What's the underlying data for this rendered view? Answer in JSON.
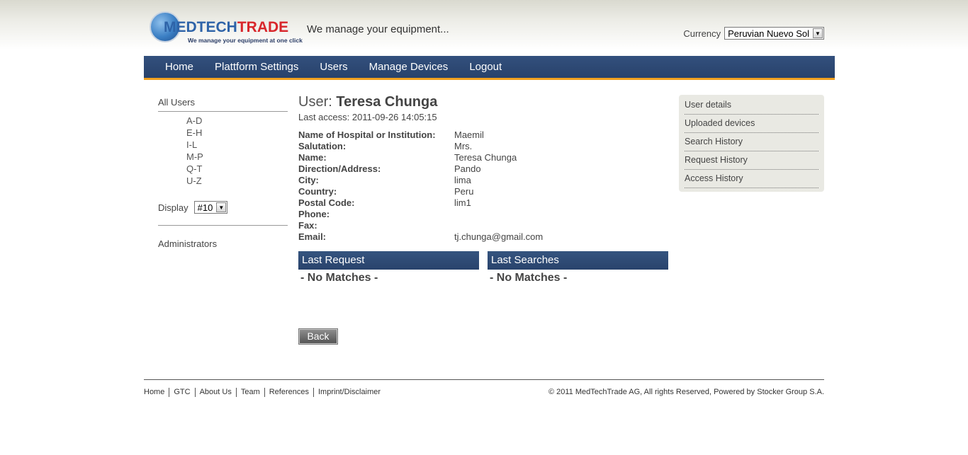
{
  "header": {
    "logo_med": "MEDTECH",
    "logo_trade": "TRADE",
    "logo_tagline": "We manage your equipment at one click",
    "tagline": "We manage your equipment...",
    "currency_label": "Currency",
    "currency_value": "Peruvian Nuevo Sol"
  },
  "nav": [
    "Home",
    "Plattform Settings",
    "Users",
    "Manage Devices",
    "Logout"
  ],
  "sidebar": {
    "all_users": "All Users",
    "letters": [
      "A-D",
      "E-H",
      "I-L",
      "M-P",
      "Q-T",
      "U-Z"
    ],
    "display_label": "Display",
    "display_value": "#10",
    "administrators": "Administrators"
  },
  "user": {
    "title_prefix": "User:",
    "name": "Teresa Chunga",
    "last_access": "Last access: 2011-09-26 14:05:15",
    "fields": [
      {
        "label": "Name of Hospital or Institution:",
        "value": "Maemil"
      },
      {
        "label": "Salutation:",
        "value": "Mrs."
      },
      {
        "label": "Name:",
        "value": "Teresa Chunga"
      },
      {
        "label": "Direction/Address:",
        "value": "Pando"
      },
      {
        "label": "City:",
        "value": "lima"
      },
      {
        "label": "Country:",
        "value": "Peru"
      },
      {
        "label": "Postal Code:",
        "value": "lim1"
      },
      {
        "label": "Phone:",
        "value": ""
      },
      {
        "label": "Fax:",
        "value": ""
      },
      {
        "label": "Email:",
        "value": "tj.chunga@gmail.com"
      }
    ]
  },
  "panels": {
    "last_request_title": "Last Request",
    "last_request_body": "- No Matches -",
    "last_searches_title": "Last Searches",
    "last_searches_body": "- No Matches -"
  },
  "back_label": "Back",
  "right_menu": [
    "User details",
    "Uploaded devices",
    "Search History",
    "Request History",
    "Access History"
  ],
  "footer": {
    "links": [
      "Home",
      "GTC",
      "About Us",
      "Team",
      "References",
      "Imprint/Disclaimer"
    ],
    "copyright": "© 2011 MedTechTrade AG, All rights Reserved, Powered by Stocker Group S.A."
  }
}
